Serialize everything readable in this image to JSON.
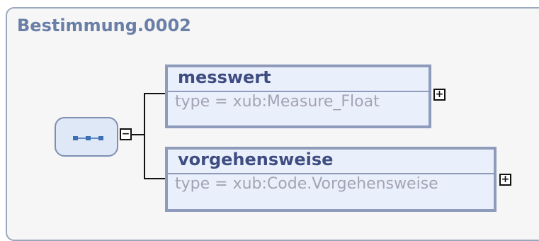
{
  "title": "Bestimmung.0002",
  "collapse_symbol": "−",
  "expand_symbol": "+",
  "elements": [
    {
      "name": "messwert",
      "type": "type = xub:Measure_Float"
    },
    {
      "name": "vorgehensweise",
      "type": "type = xub:Code.Vorgehensweise"
    }
  ]
}
